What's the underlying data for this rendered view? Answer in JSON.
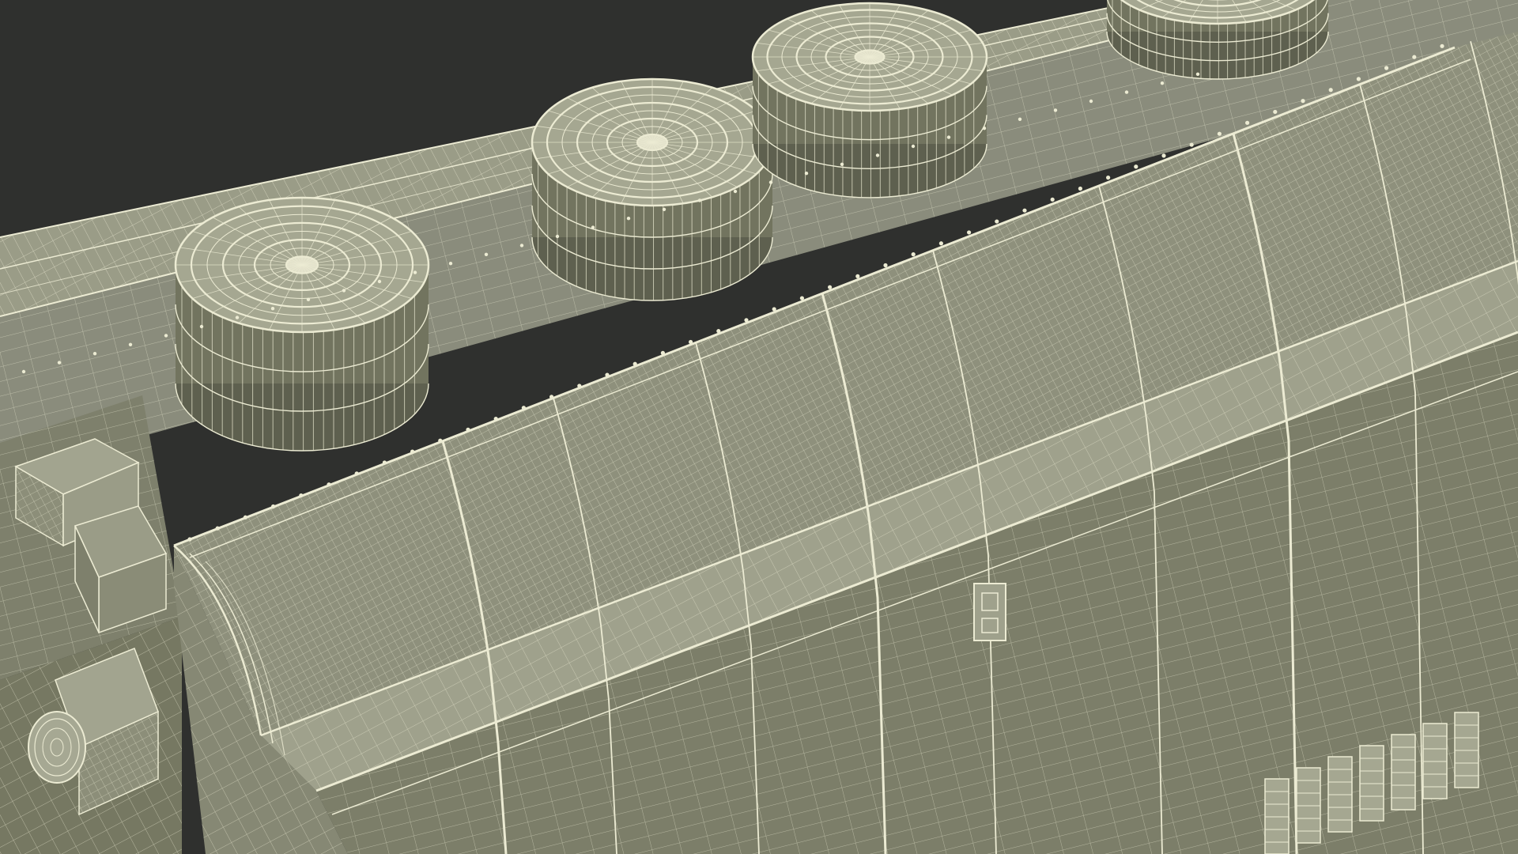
{
  "scene": {
    "subject": "wireframe-locomotive-roof",
    "palette": {
      "background": "#2f302e",
      "surface": "#8a8c7c",
      "surface_dark": "#72745f",
      "surface_light": "#a5a791",
      "wire": "#ecebd3",
      "wire_dim": "#cfcdb4",
      "shadow": "#5e604f"
    },
    "fans": [
      {
        "name": "fan-left"
      },
      {
        "name": "fan-middle"
      },
      {
        "name": "fan-right"
      },
      {
        "name": "fan-far-right"
      }
    ]
  }
}
